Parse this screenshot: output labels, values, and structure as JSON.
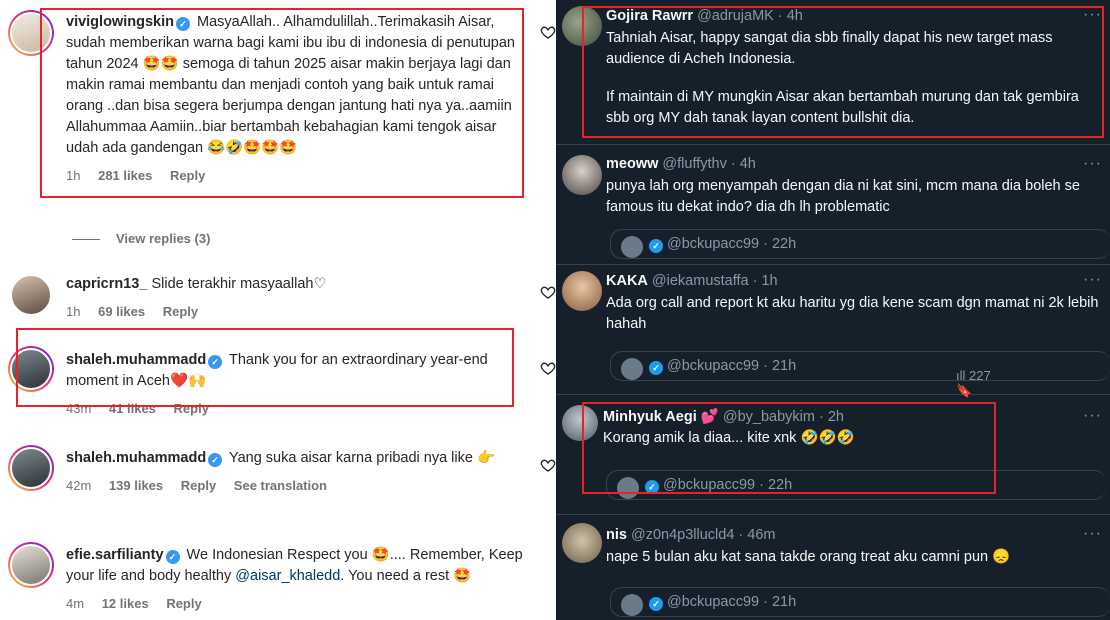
{
  "instagram": {
    "comments": [
      {
        "username": "viviglowingskin",
        "verified": true,
        "text": "MasyaAllah.. Alhamdulillah..Terimakasih Aisar, sudah memberikan warna bagi kami ibu ibu di indonesia di penutupan tahun 2024 🤩🤩 semoga di tahun 2025 aisar makin berjaya lagi dan makin ramai membantu dan menjadi contoh yang baik untuk ramai orang ..dan bisa segera berjumpa dengan jantung hati nya ya..aamiin Allahummaa Aamiin..biar bertambah kebahagian kami tengok aisar udah ada gandengan 😂🤣🤩🤩🤩",
        "time": "1h",
        "likes": "281 likes",
        "reply": "Reply"
      },
      {
        "username": "capricrn13_",
        "verified": false,
        "text": "Slide terakhir masyaallah♡",
        "time": "1h",
        "likes": "69 likes",
        "reply": "Reply"
      },
      {
        "username": "shaleh.muhammadd",
        "verified": true,
        "text": "Thank you for an extraordinary year-end moment in Aceh❤️🙌",
        "time": "43m",
        "likes": "41 likes",
        "reply": "Reply"
      },
      {
        "username": "shaleh.muhammadd",
        "verified": true,
        "text": "Yang suka aisar karna pribadi nya like 👉",
        "time": "42m",
        "likes": "139 likes",
        "reply": "Reply",
        "translation": "See translation"
      },
      {
        "username": "efie.sarfilianty",
        "verified": true,
        "text_before": "We Indonesian Respect you 🤩.... Remember, Keep your life and body healthy ",
        "mention": "@aisar_khaledd",
        "text_after": ". You need a rest 🤩",
        "time": "4m",
        "likes": "12 likes",
        "reply": "Reply"
      }
    ],
    "view_replies": "View replies (3)"
  },
  "twitter": {
    "tweets": [
      {
        "name": "Gojira Rawrr",
        "handle": "@adrujaMK",
        "time": "4h",
        "lines": [
          "Tahniah Aisar, happy sangat dia sbb finally dapat his new target mass audience di Acheh Indonesia.",
          "If maintain di MY mungkin Aisar akan bertambah murung dan tak gembira sbb org MY dah tanak layan content bullshit dia."
        ]
      },
      {
        "name": "meoww",
        "handle": "@fluffythv",
        "time": "4h",
        "text": "punya lah org menyampah dengan dia ni kat sini, mcm mana dia boleh se famous itu dekat indo? dia dh lh problematic",
        "quote": "@bckupacc99 · 22h"
      },
      {
        "name": "KAKA",
        "handle": "@iekamustaffa",
        "time": "1h",
        "text": "Ada org call and report kt aku haritu yg dia kene scam dgn mamat ni 2k lebih hahah",
        "quote": "@bckupacc99 · 21h"
      },
      {
        "name": "Minhyuk Aegi 💕",
        "handle": "@by_babykim",
        "time": "2h",
        "text": "Korang amik la diaa... kite xnk 🤣🤣🤣",
        "quote": "@bckupacc99 · 22h"
      },
      {
        "name": "nis",
        "handle": "@z0n4p3llucld4",
        "time": "46m",
        "text": "nape 5 bulan aku kat sana takde orang treat aku camni pun 😞",
        "quote": "@bckupacc99 · 21h"
      }
    ],
    "stats": [
      "ıll 227",
      "🔖"
    ],
    "more_icon": "···"
  },
  "colors": {
    "highlight": "#e8222b",
    "twitter_bg": "#15202b",
    "verified_ig": "#3897f0",
    "verified_tw": "#1d9bf0"
  }
}
